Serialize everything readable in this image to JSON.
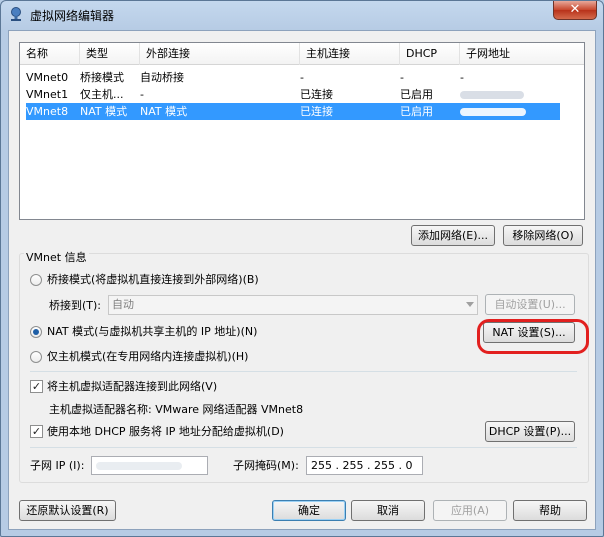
{
  "window": {
    "title": "虚拟网络编辑器",
    "close_glyph": "✕"
  },
  "table": {
    "headers": [
      "名称",
      "类型",
      "外部连接",
      "主机连接",
      "DHCP",
      "子网地址"
    ],
    "rows": [
      {
        "name": "VMnet0",
        "type": "桥接模式",
        "external": "自动桥接",
        "host": "-",
        "dhcp": "-",
        "subnet": "-",
        "selected": false
      },
      {
        "name": "VMnet1",
        "type": "仅主机...",
        "external": "-",
        "host": "已连接",
        "dhcp": "已启用",
        "subnet": "",
        "selected": false
      },
      {
        "name": "VMnet8",
        "type": "NAT 模式",
        "external": "NAT 模式",
        "host": "已连接",
        "dhcp": "已启用",
        "subnet": "",
        "selected": true
      }
    ]
  },
  "list_buttons": {
    "add": "添加网络(E)...",
    "remove": "移除网络(O)"
  },
  "vmnet_info": {
    "group_title": "VMnet 信息",
    "bridged_label": "桥接模式(将虚拟机直接连接到外部网络)(B)",
    "bridge_to_label": "桥接到(T):",
    "bridge_to_value": "自动",
    "auto_settings": "自动设置(U)...",
    "nat_label": "NAT 模式(与虚拟机共享主机的 IP 地址)(N)",
    "nat_settings": "NAT 设置(S)...",
    "hostonly_label": "仅主机模式(在专用网络内连接虚拟机)(H)",
    "connect_adapter_label": "将主机虚拟适配器连接到此网络(V)",
    "adapter_name_label": "主机虚拟适配器名称: VMware 网络适配器 VMnet8",
    "dhcp_label": "使用本地 DHCP 服务将 IP 地址分配给虚拟机(D)",
    "dhcp_settings": "DHCP 设置(P)...",
    "subnet_ip_label": "子网 IP (I):",
    "subnet_ip_value": "",
    "subnet_mask_label": "子网掩码(M):",
    "subnet_mask_value": "255 . 255 . 255 . 0"
  },
  "footer": {
    "restore": "还原默认设置(R)",
    "ok": "确定",
    "cancel": "取消",
    "apply": "应用(A)",
    "help": "帮助"
  },
  "colors": {
    "selection": "#3399ff",
    "highlight_ring": "#e2201f"
  }
}
